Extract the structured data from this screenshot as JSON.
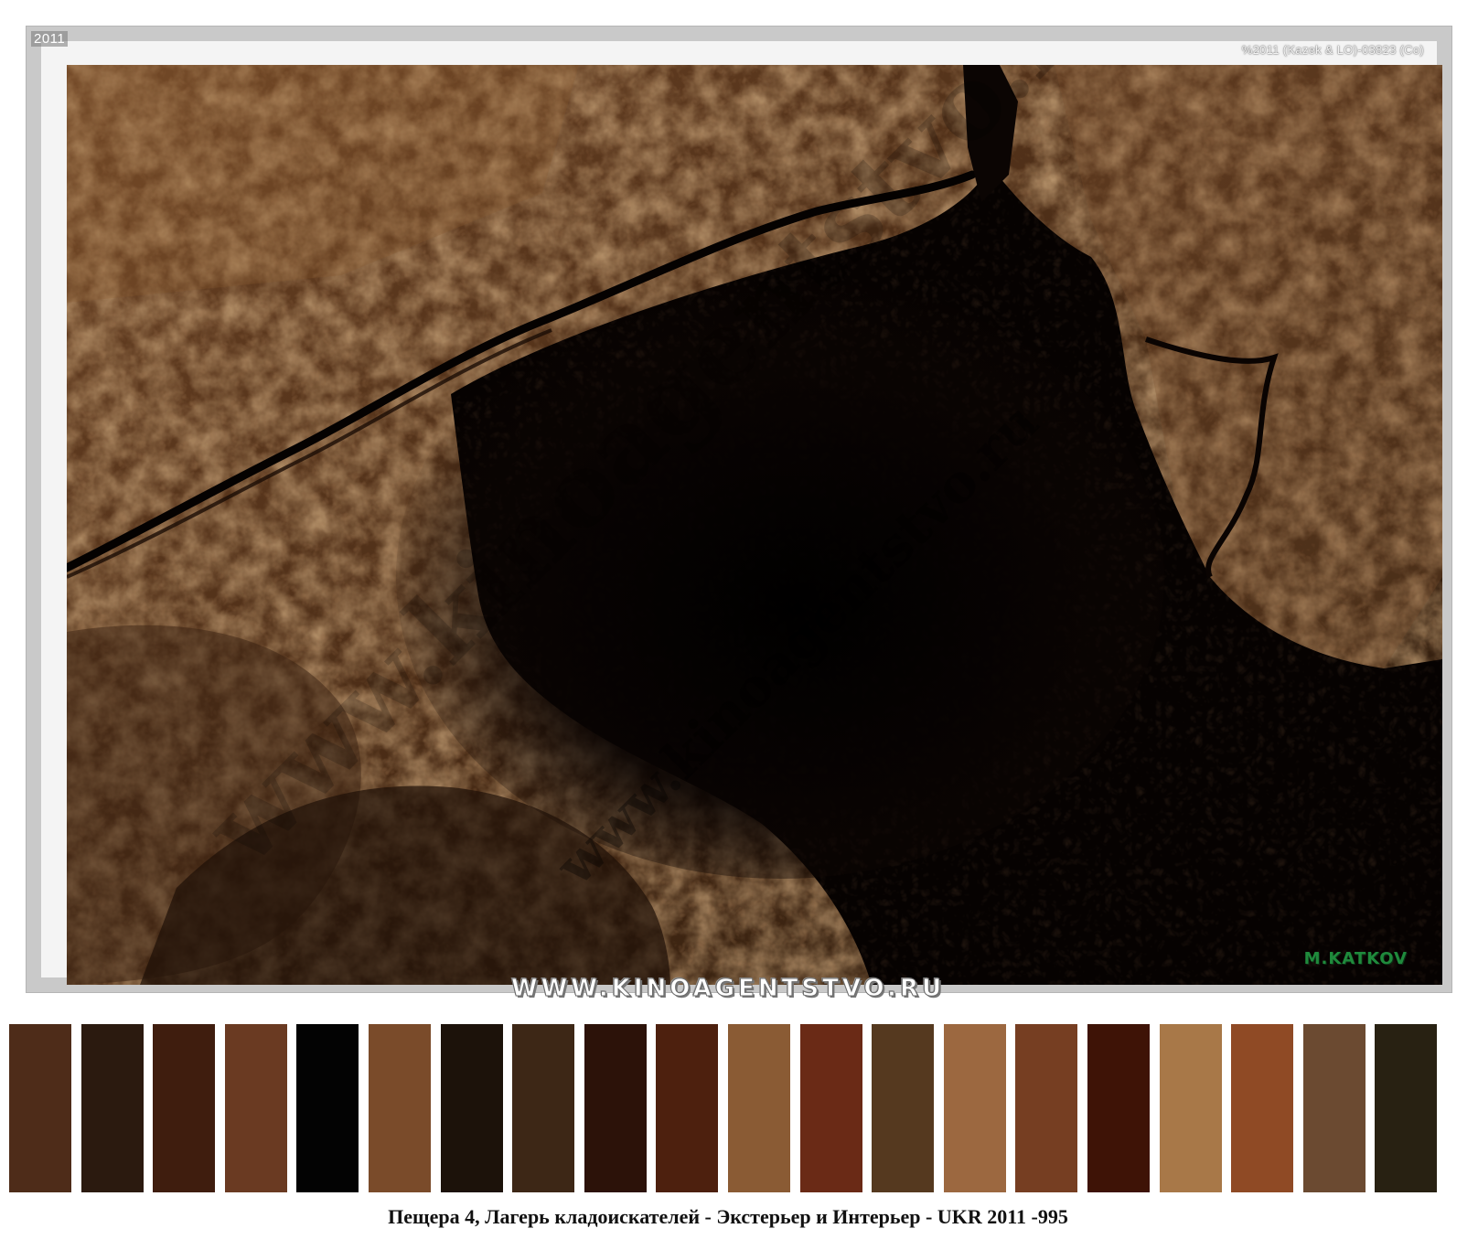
{
  "photo": {
    "year_stamp": "2011",
    "copyright_stamp": "%2011 (Kazek & LO)-03823 (Co)",
    "author_mark": "M.KATKOV",
    "watermark_text": "www.kinoagentstvo.ru"
  },
  "site_banner": "WWW.KINOAGENTSTVO.RU",
  "palette": {
    "colors": [
      "#4e2c19",
      "#2b1a0f",
      "#3f1d0e",
      "#6a3a22",
      "#030303",
      "#7a4b2a",
      "#1c120a",
      "#3d2716",
      "#2c1209",
      "#4d200e",
      "#8a5b34",
      "#6a2a16",
      "#55391f",
      "#9c6840",
      "#763e22",
      "#3e1306",
      "#a87848",
      "#8f4a25",
      "#6b4a31",
      "#282112"
    ]
  },
  "caption": "Пещера 4, Лагерь кладоискателей - Экстерьер и Интерьер - UKR 2011 -995"
}
